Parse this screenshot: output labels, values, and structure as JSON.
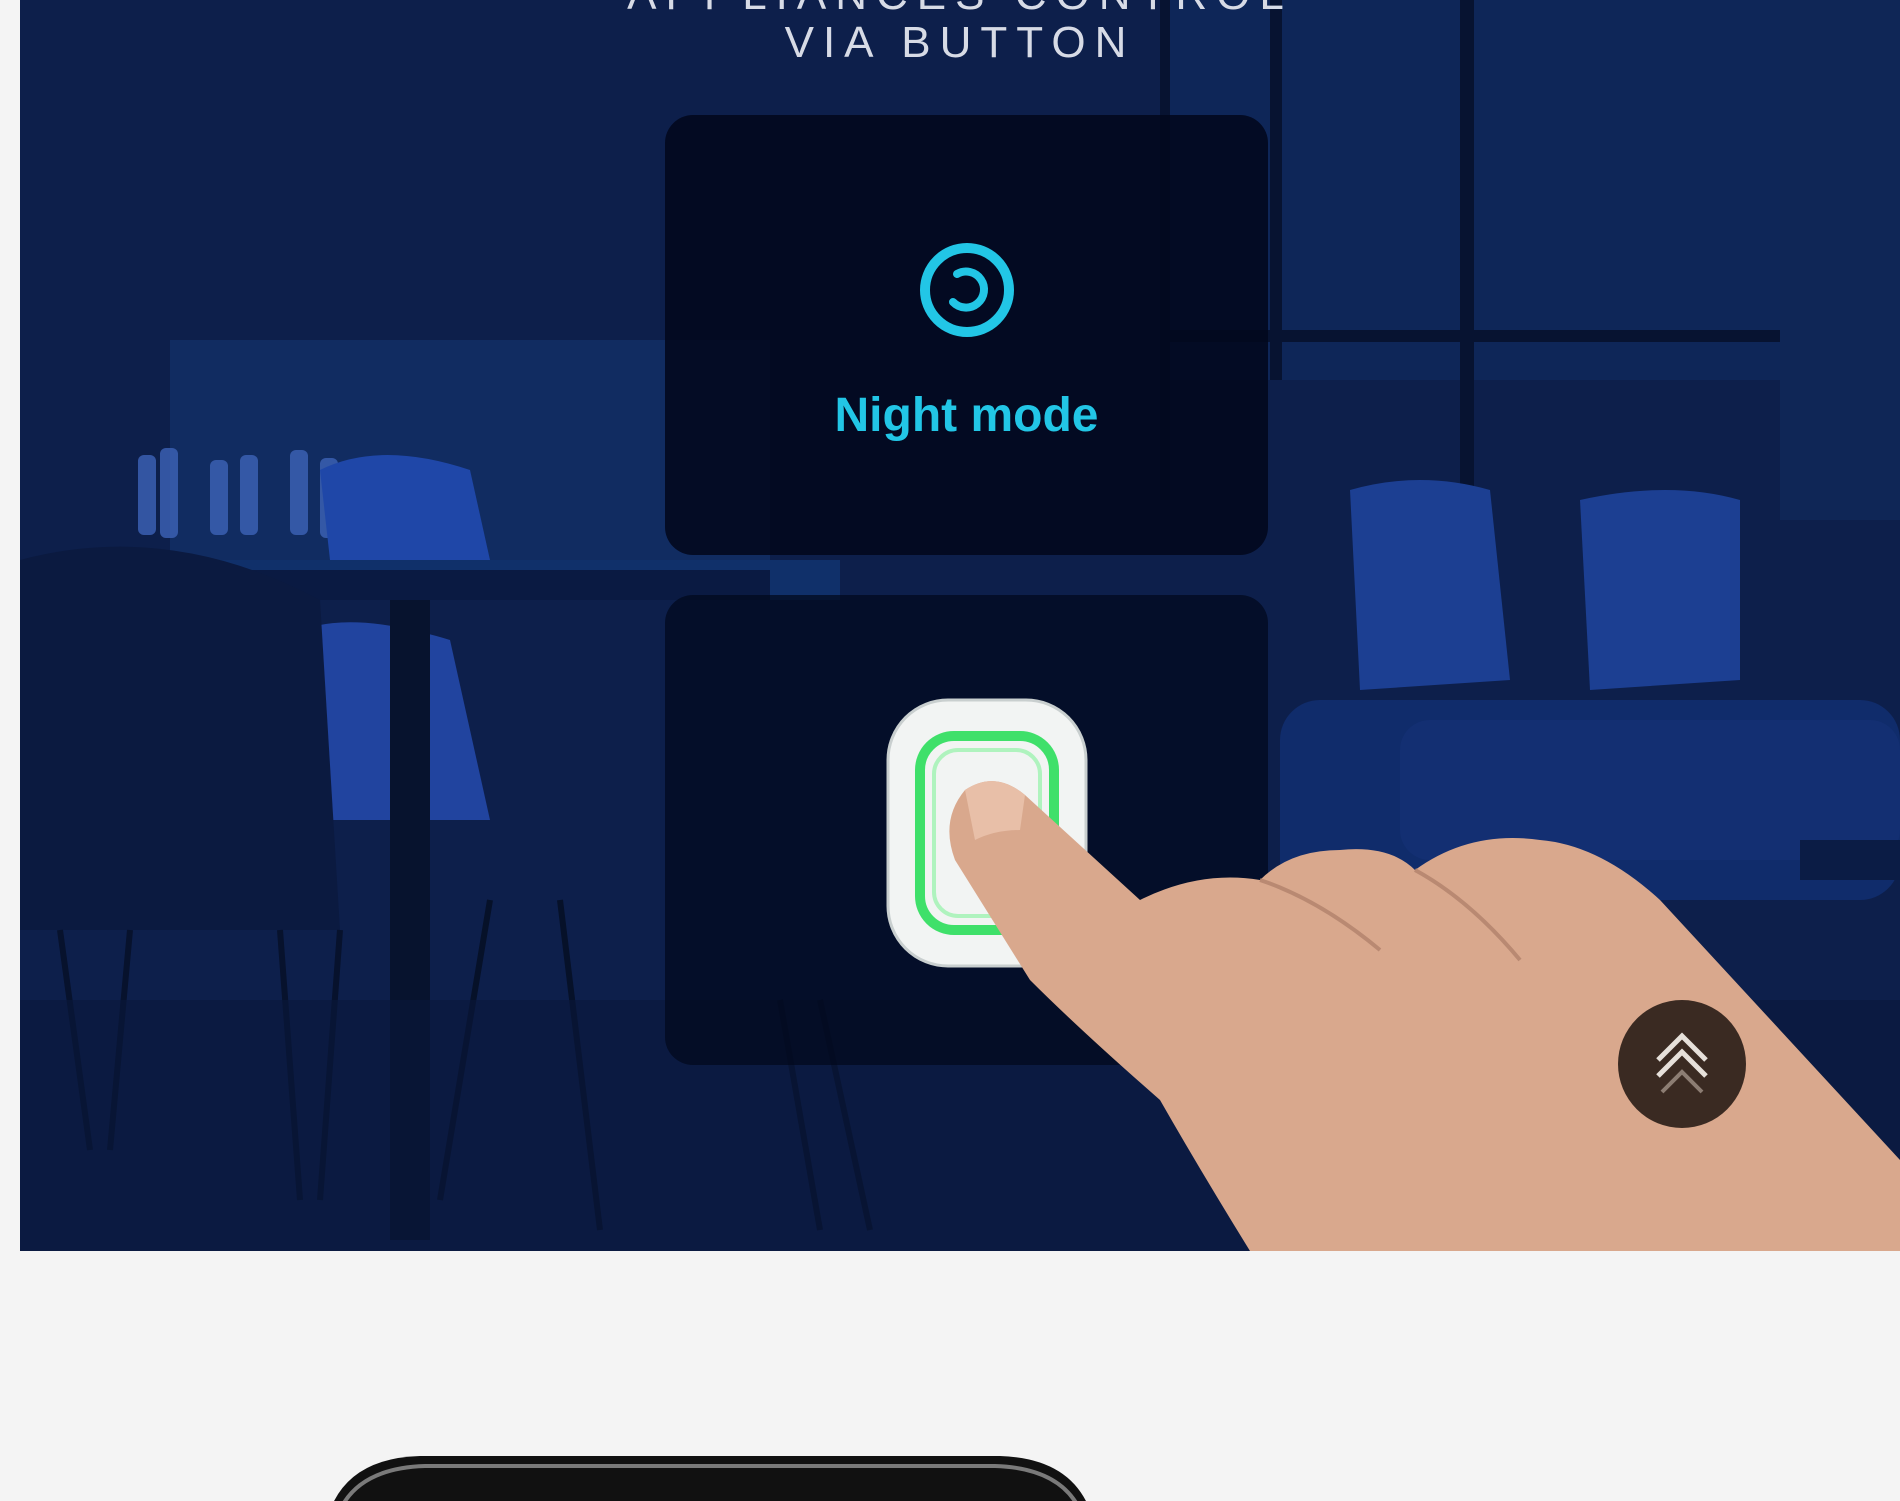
{
  "hero": {
    "headline_line1": "APPLIANCES CONTROL",
    "headline_line2": "VIA BUTTON",
    "mode_label": "Night mode",
    "mode_icon": "night-mode-icon",
    "device": "smart-button-device"
  },
  "scroll_top": {
    "icon": "double-chevron-up-icon"
  },
  "colors": {
    "accent": "#22c6e6",
    "device_glow": "#3fe06a",
    "hero_bg": "#0e2150",
    "scroll_button": "#3a2a22"
  }
}
